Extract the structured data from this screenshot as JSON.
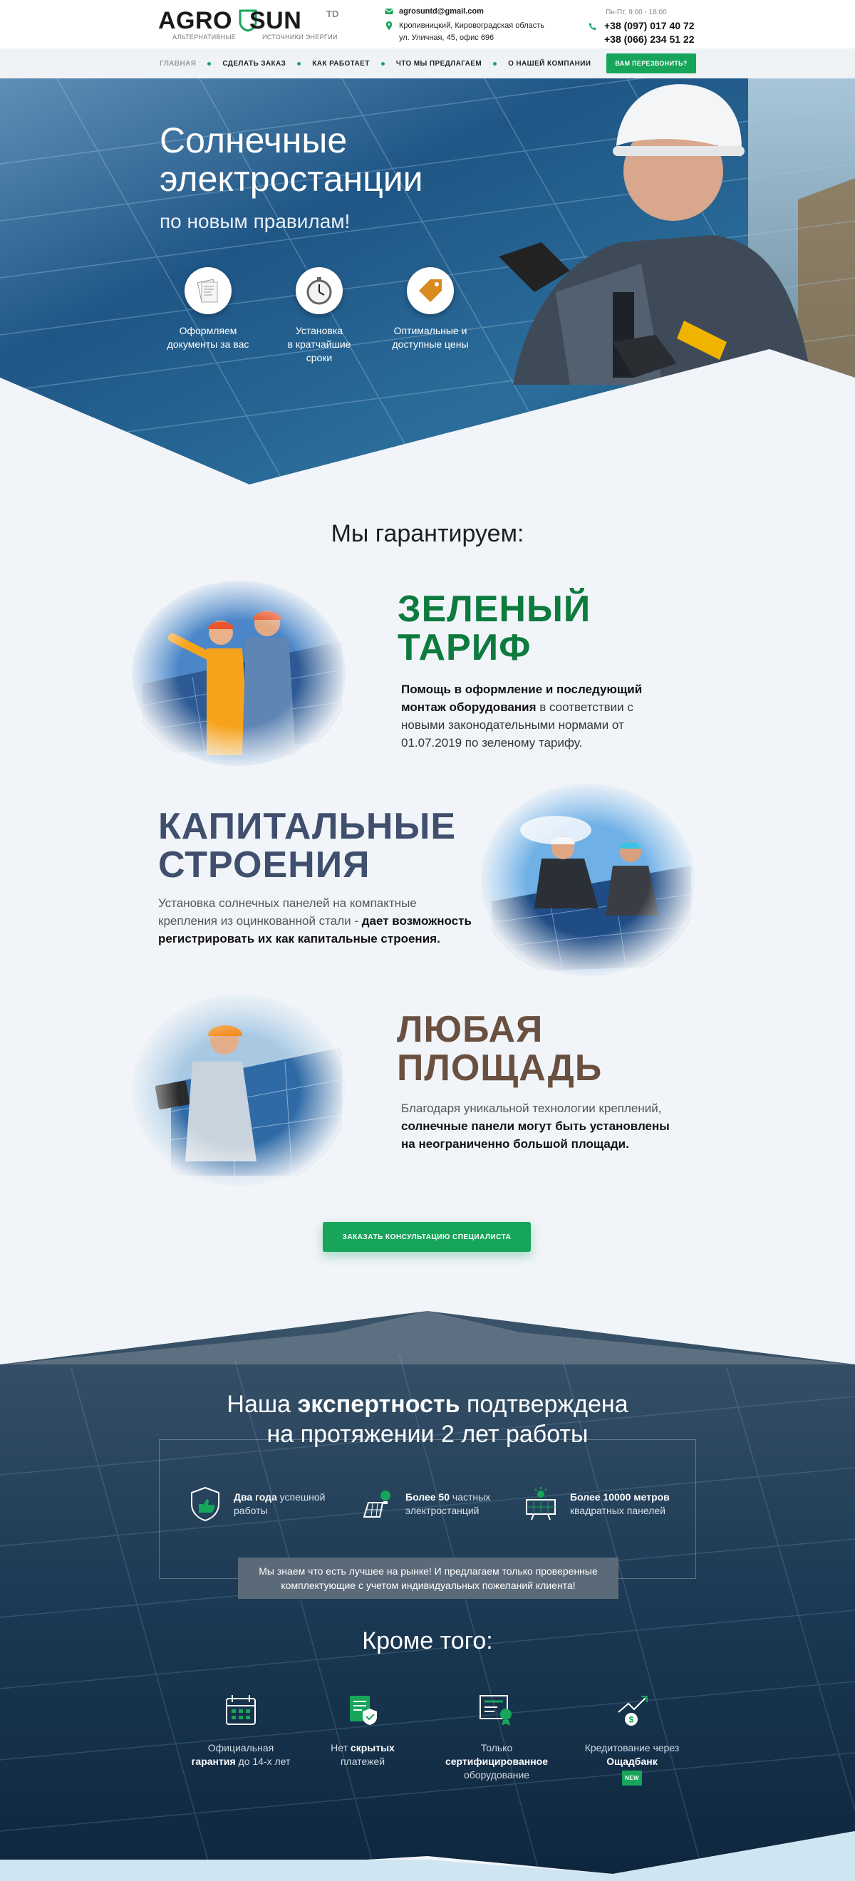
{
  "header": {
    "logo": {
      "left": "AGRO",
      "right": "SUN",
      "suffix": "TD",
      "sub_left": "АЛЬТЕРНАТИВНЫЕ",
      "sub_right": "ИСТОЧНИКИ ЭНЕРГИИ"
    },
    "email": "agrosuntd@gmail.com",
    "address_line1": "Кропивницкий, Кировоградская область",
    "address_line2": "ул. Уличная, 45, офис 696",
    "hours": "Пн-Пт, 9:00 - 18:00",
    "phone1": "+38 (097) 017 40 72",
    "phone2": "+38 (066) 234 51 22",
    "icons": {
      "email": "envelope-icon",
      "address": "location-pin-icon",
      "phone": "phone-icon"
    }
  },
  "nav": {
    "items": [
      "ГЛАВНАЯ",
      "СДЕЛАТЬ ЗАКАЗ",
      "КАК РАБОТАЕТ",
      "ЧТО МЫ ПРЕДЛАГАЕМ",
      "О НАШЕЙ КОМПАНИИ"
    ],
    "active": "ГЛАВНАЯ",
    "call_button": "ВАМ ПЕРЕЗВОНИТЬ?"
  },
  "hero": {
    "title_line1": "Солнечные",
    "title_line2": "электростанции",
    "subtitle": "по новым правилам!",
    "features": [
      {
        "icon": "documents-icon",
        "line1": "Оформляем",
        "line2": "документы за вас",
        "line3": ""
      },
      {
        "icon": "stopwatch-icon",
        "line1": "Установка",
        "line2": "в кратчайшие",
        "line3": "сроки"
      },
      {
        "icon": "price-tag-icon",
        "line1": "Оптимальные и",
        "line2": "доступные цены",
        "line3": ""
      }
    ]
  },
  "guarantee": {
    "title": "Мы гарантируем:",
    "blocks": [
      {
        "head1": "ЗЕЛЕНЫЙ",
        "head2": "ТАРИФ",
        "bold": "Помощь в оформление и последующий монтаж оборудования",
        "rest": " в соответствии с новыми законодательными нормами от 01.07.2019 по зеленому тарифу."
      },
      {
        "head1": "КАПИТАЛЬНЫЕ",
        "head2": "СТРОЕНИЯ",
        "plain": "Установка солнечных панелей на компактные крепления из оцинкованной стали - ",
        "bold": "дает возможность регистрировать их как капитальные строения."
      },
      {
        "head1": "ЛЮБАЯ",
        "head2": "ПЛОЩАДЬ",
        "plain": "Благодаря уникальной технологии креплений, ",
        "bold": "солнечные панели могут быть установлены на неограниченно большой площади."
      }
    ],
    "cta": "ЗАКАЗАТЬ КОНСУЛЬТАЦИЮ СПЕЦИАЛИСТА",
    "colors": {
      "green": "#0d7a3e",
      "slate": "#3f4f6d",
      "bronze": "#6a5040"
    }
  },
  "expertise": {
    "title_pre": "Наша ",
    "title_bold": "экспертность",
    "title_post": " подтверждена",
    "title_line2": "на протяжении 2 лет работы",
    "stats": [
      {
        "icon": "shield-thumbs-up-icon",
        "bold": "Два года",
        "rest1": " успешной",
        "line2": "работы"
      },
      {
        "icon": "solar-panel-bulb-icon",
        "bold": "Более 50",
        "rest1": " частных",
        "line2": "электростанций"
      },
      {
        "icon": "solar-panel-sun-icon",
        "bold": "Более 10000 метров",
        "rest1": "",
        "line2": "квадратных панелей"
      }
    ],
    "note": "Мы знаем что есть лучшее на рынке! И предлагаем только проверенные комплектующие с учетом индивидуальных пожеланий клиента!",
    "more_title": "Кроме того:",
    "perks": [
      {
        "icon": "calendar-icon",
        "line1": "Официальная",
        "bold": "гарантия",
        "rest": " до 14-х лет"
      },
      {
        "icon": "shield-document-icon",
        "pre": "Нет ",
        "bold": "скрытых",
        "line2": "платежей"
      },
      {
        "icon": "certificate-icon",
        "line1": "Только",
        "bold": "сертифицированное",
        "line3": "оборудование"
      },
      {
        "icon": "money-growth-icon",
        "line1": "Кредитование через",
        "bold": "Ощадбанк",
        "badge": "NEW"
      }
    ]
  },
  "accent": "#17a55b"
}
